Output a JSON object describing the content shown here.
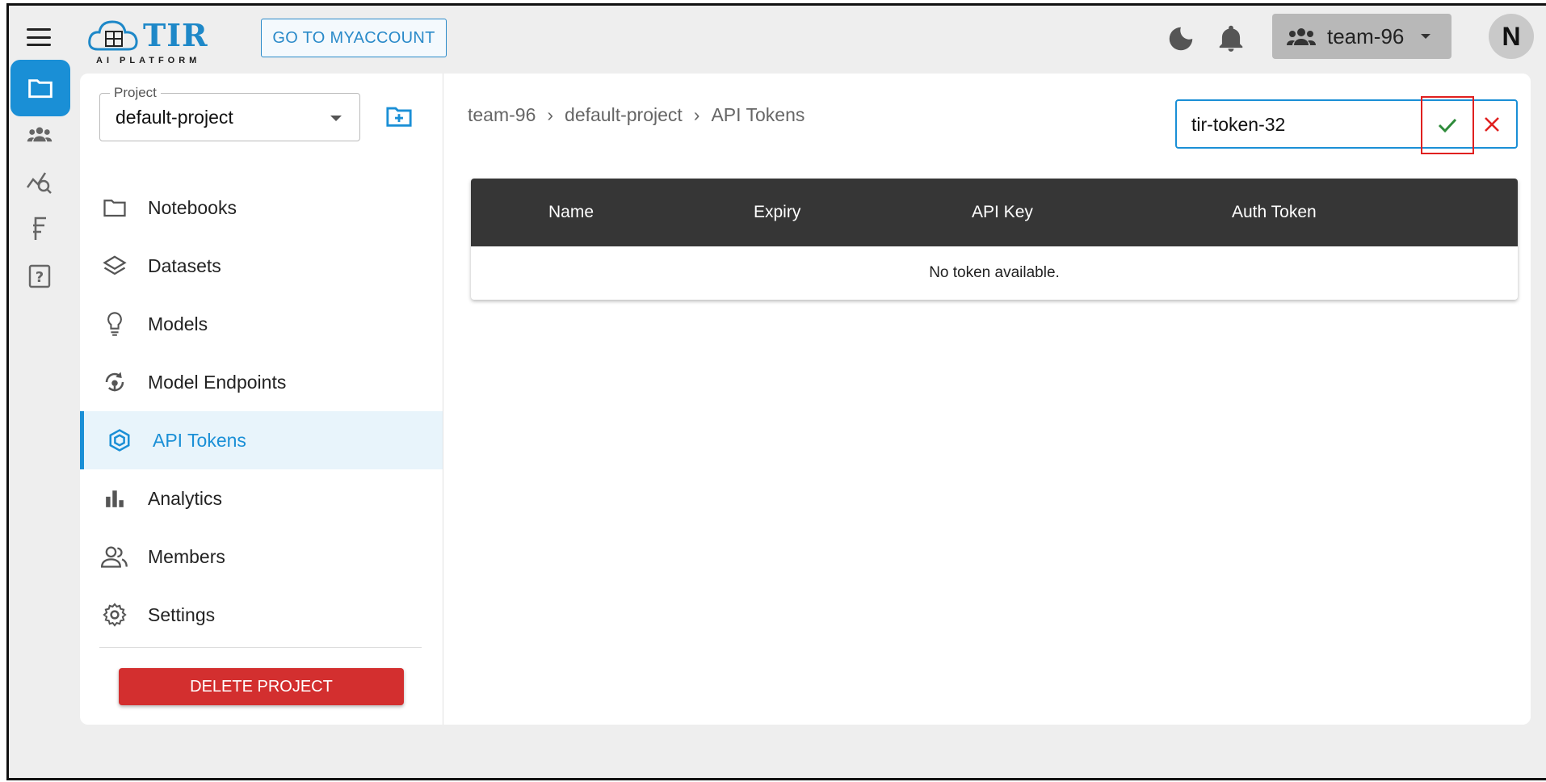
{
  "header": {
    "logo_text": "TIR",
    "logo_subtitle": "AI PLATFORM",
    "myaccount_label": "GO TO MYACCOUNT",
    "team_label": "team-96",
    "avatar_initial": "N"
  },
  "rail": {
    "items": [
      {
        "icon": "folder-icon",
        "active": true
      },
      {
        "icon": "team-icon",
        "active": false
      },
      {
        "icon": "analytics-search-icon",
        "active": false
      },
      {
        "icon": "currency-icon",
        "active": false
      },
      {
        "icon": "help-icon",
        "active": false
      }
    ]
  },
  "sidebar": {
    "project_label": "Project",
    "project_value": "default-project",
    "items": [
      {
        "label": "Notebooks",
        "icon": "folder-icon"
      },
      {
        "label": "Datasets",
        "icon": "layers-icon"
      },
      {
        "label": "Models",
        "icon": "lightbulb-icon"
      },
      {
        "label": "Model Endpoints",
        "icon": "endpoint-icon"
      },
      {
        "label": "API Tokens",
        "icon": "cube-icon",
        "active": true
      },
      {
        "label": "Analytics",
        "icon": "bar-chart-icon"
      },
      {
        "label": "Members",
        "icon": "members-icon"
      },
      {
        "label": "Settings",
        "icon": "gear-icon"
      }
    ],
    "delete_label": "DELETE PROJECT"
  },
  "breadcrumb": [
    "team-96",
    "default-project",
    "API Tokens"
  ],
  "token_form": {
    "value": "tir-token-32"
  },
  "table": {
    "columns": [
      "Name",
      "Expiry",
      "API Key",
      "Auth Token"
    ],
    "empty_text": "No token available."
  },
  "colors": {
    "accent": "#1a8fd6",
    "danger": "#d32f2f",
    "header_dark": "#363636",
    "confirm_green": "#2e8b3a",
    "cancel_red": "#e0201f"
  }
}
